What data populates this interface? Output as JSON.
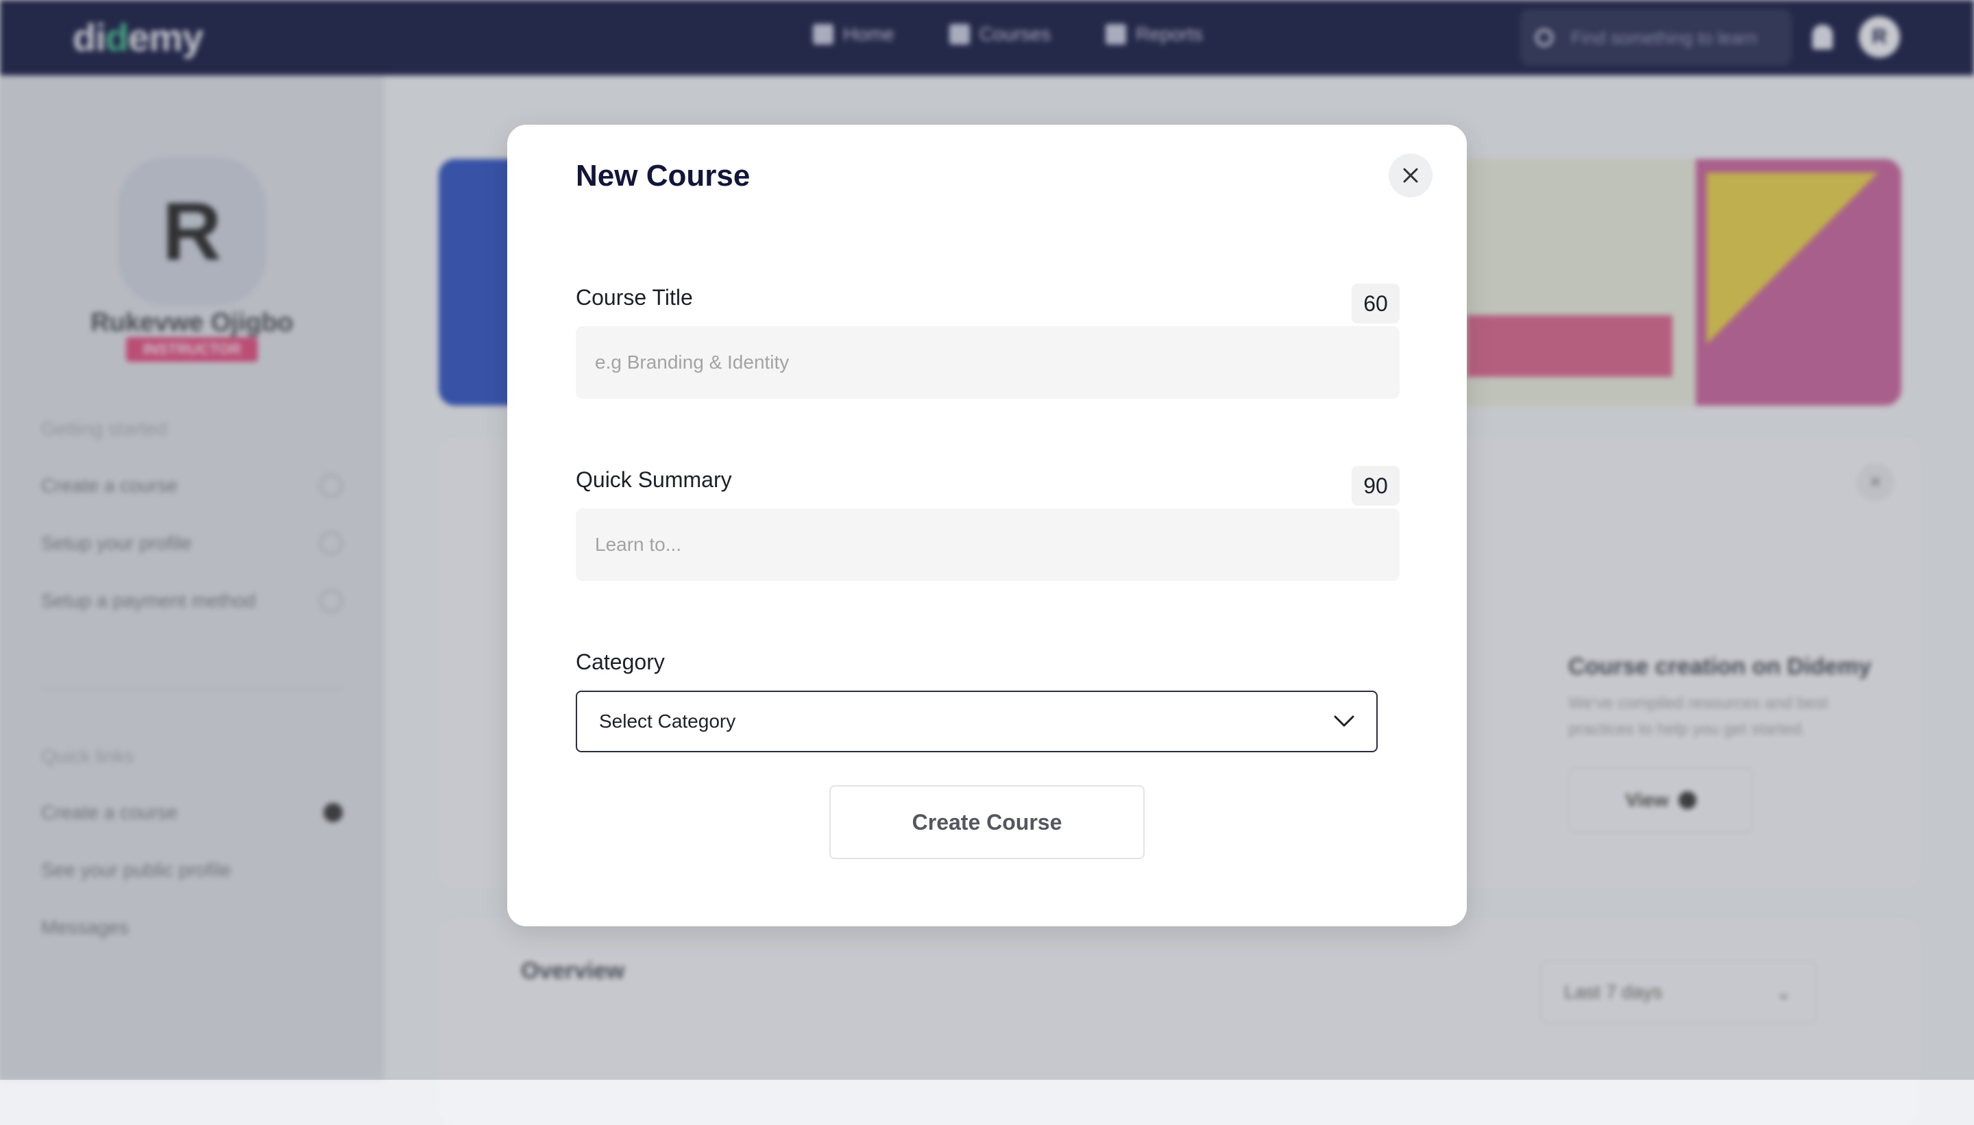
{
  "app": {
    "logo": {
      "text_start": "di",
      "text_dot": "d",
      "text_end": "emy"
    },
    "nav": [
      {
        "label": "Home",
        "icon": "home-icon"
      },
      {
        "label": "Courses",
        "icon": "book-icon"
      },
      {
        "label": "Reports",
        "icon": "clipboard-icon"
      }
    ],
    "search": {
      "placeholder": "Find something to learn"
    },
    "user_initial": "R"
  },
  "sidebar": {
    "avatar_initial": "R",
    "name": "Rukevwe Ojigbo",
    "role": "INSTRUCTOR",
    "getting_started_heading": "Getting started",
    "getting_started": [
      "Create a course",
      "Setup your profile",
      "Setup a payment method"
    ],
    "quick_links_heading": "Quick links",
    "quick_links": [
      "Create a course",
      "See your public profile",
      "Messages"
    ]
  },
  "main": {
    "resource_card": {
      "title": "Course creation on Didemy",
      "text": "We've compiled resources and best practices to help you get started.",
      "button": "View"
    },
    "overview": {
      "title": "Overview",
      "range": "Last 7 days"
    }
  },
  "modal": {
    "title": "New Course",
    "course_title": {
      "label": "Course Title",
      "counter": "60",
      "placeholder": "e.g Branding & Identity",
      "value": ""
    },
    "summary": {
      "label": "Quick Summary",
      "counter": "90",
      "placeholder": "Learn to...",
      "value": ""
    },
    "category": {
      "label": "Category",
      "selected": "Select Category"
    },
    "submit_label": "Create Course"
  },
  "colors": {
    "topbar": "#101540",
    "accent_pink": "#e0487c",
    "modal_bg": "#ffffff",
    "input_bg": "#f5f5f5"
  }
}
